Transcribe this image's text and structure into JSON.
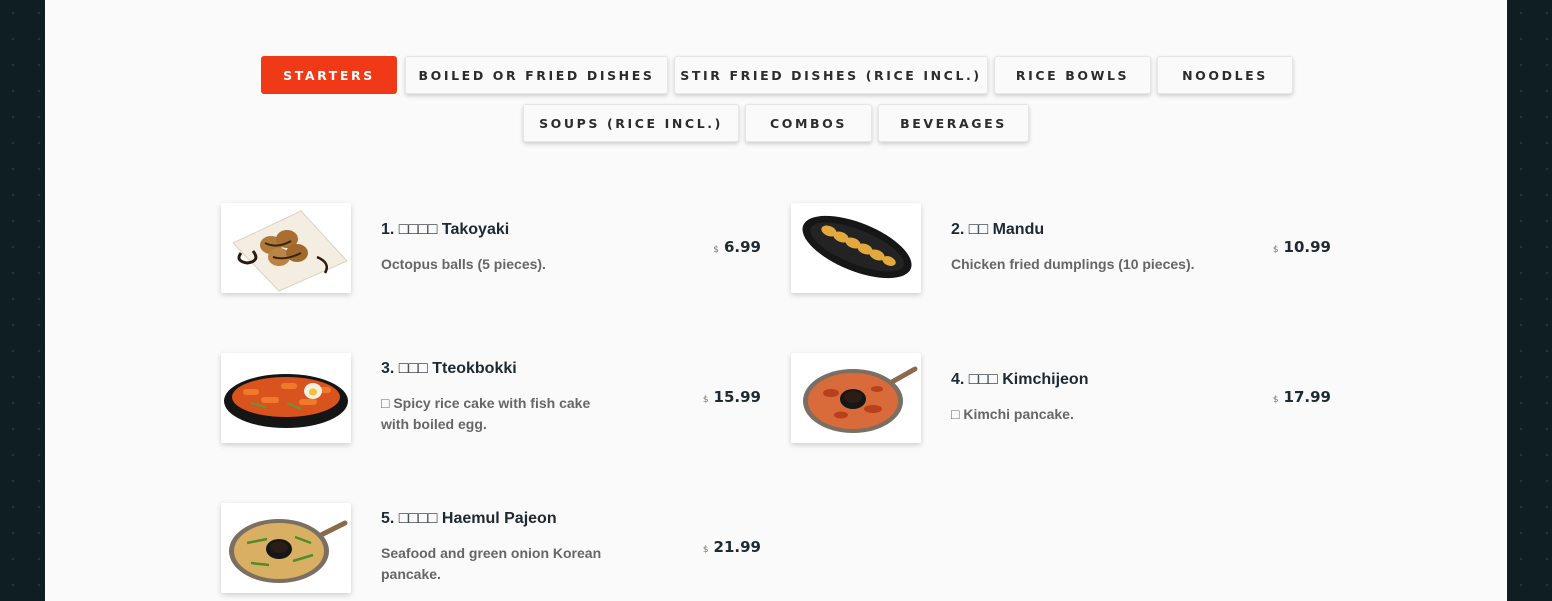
{
  "tabs": [
    {
      "label": "STARTERS",
      "active": true
    },
    {
      "label": "BOILED OR FRIED DISHES"
    },
    {
      "label": "STIR FRIED DISHES (RICE INCL.)"
    },
    {
      "label": "RICE BOWLS"
    },
    {
      "label": "NOODLES"
    },
    {
      "label": "SOUPS (RICE INCL.)"
    },
    {
      "label": "COMBOS"
    },
    {
      "label": "BEVERAGES"
    }
  ],
  "menu": [
    {
      "name": "1. □□□□ Takoyaki",
      "description": "Octopus balls (5 pieces).",
      "currency": "$",
      "price": "6.99"
    },
    {
      "name": "2. □□ Mandu",
      "description": "Chicken fried dumplings (10 pieces).",
      "currency": "$",
      "price": "10.99"
    },
    {
      "name": "3. □□□ Tteokbokki",
      "description": "□ Spicy rice cake with fish cake with boiled egg.",
      "currency": "$",
      "price": "15.99"
    },
    {
      "name": "4. □□□ Kimchijeon",
      "description": "□ Kimchi pancake.",
      "currency": "$",
      "price": "17.99"
    },
    {
      "name": "5. □□□□ Haemul Pajeon",
      "description": "Seafood and green onion Korean pancake.",
      "currency": "$",
      "price": "21.99"
    }
  ],
  "colors": {
    "accent": "#f03a17",
    "panel": "#fafafa",
    "background": "#0f1e22"
  }
}
